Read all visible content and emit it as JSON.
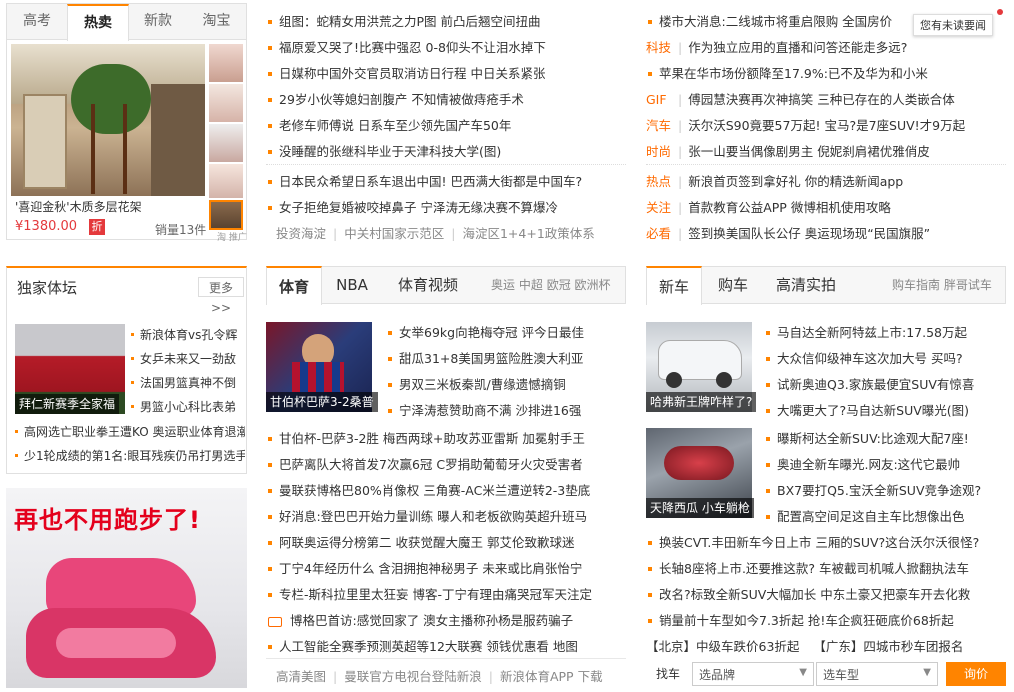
{
  "shop": {
    "tabs": [
      "高考",
      "热卖",
      "新款",
      "淘宝"
    ],
    "caption": "'喜迎金秋'木质多层花架",
    "price": "¥1380.00",
    "badge": "折",
    "sales": "销量13件",
    "logo": "淘 推广"
  },
  "top_news": {
    "items": [
      "组图：蛇精女用洪荒之力P图 前凸后翘空间扭曲",
      "福原爱又哭了!比赛中强忍 0-8仰头不让泪水掉下",
      "日媒称中国外交官员取消访日行程 中日关系紧张",
      "29岁小伙等媳妇剖腹产 不知情被做痔疮手术",
      "老修车师傅说 日系车至少领先国产车50年",
      "没睡醒的张继科毕业于天津科技大学(图)",
      "日本民众希望日系车退出中国! 巴西满大街都是中国车?",
      "女子拒绝复婚被咬掉鼻子 宁泽涛无缘决赛不算爆冷"
    ],
    "footer": [
      "投资海淀",
      "中关村国家示范区",
      "海淀区1+4+1政策体系"
    ]
  },
  "right_news": {
    "items": [
      {
        "tag": "",
        "text": "楼市大消息:二线城市将重启限购 全国房价"
      },
      {
        "tag": "科技",
        "text": "作为独立应用的直播和问答还能走多远?"
      },
      {
        "tag": "",
        "text": "苹果在华市场份额降至17.9%:已不及华为和小米"
      },
      {
        "tag": "GIF",
        "text": "傅园慧決赛再次神搞笑 三种已存在的人类嵌合体"
      },
      {
        "tag": "汽车",
        "text": "沃尔沃S90竟要57万起! 宝马?是7座SUV!才9万起"
      },
      {
        "tag": "时尚",
        "text": "张一山要当偶像剧男主 倪妮刹肩裙优雅俏皮"
      },
      {
        "tag": "热点",
        "text": "新浪首页签到拿好礼 你的精选新闻app"
      },
      {
        "tag": "关注",
        "text": "首款教育公益APP 微博相机使用攻略"
      },
      {
        "tag": "必看",
        "text": "签到换美国队长公仔 奥运现场现“民国旗服”"
      }
    ],
    "tooltip": "您有未读要闻"
  },
  "sports_side": {
    "title": "独家体坛",
    "more": "更多>>",
    "caption": "拜仁新赛季全家福",
    "list": [
      "新浪体育vs孔令辉",
      "女乒未来又一劲敌",
      "法国男篮真神不倒",
      "男篮小心科比表弟"
    ],
    "lines": [
      "高网选亡职业拳王遭KO 奥运职业体育退潮",
      "少1轮成绩的第1名:眼耳残疾仍吊打男选手"
    ]
  },
  "ad": {
    "title": "再也不用跑步了!"
  },
  "sports": {
    "tabs": [
      "体育",
      "NBA",
      "体育视频"
    ],
    "links": [
      "奥运",
      "中超",
      "欧冠",
      "欧洲杯"
    ],
    "caption": "甘伯杯巴萨3-2桑普",
    "side": [
      "女举69kg向艳梅夺冠 评今日最佳",
      "甜瓜31+8美国男篮险胜澳大利亚",
      "男双三米板秦凯/曹缘遗憾摘铜",
      "宁泽涛惹赞助商不满 沙排进16强"
    ],
    "items": [
      "甘伯杯-巴萨3-2胜 梅西两球+助攻苏亚雷斯 加冕射手王",
      "巴萨离队大将首发7次赢6冠 C罗捐助葡萄牙火灾受害者",
      "曼联获博格巴80%肖像权 三角赛-AC米兰遭逆转2-3垫底",
      "好消息:登巴巴开始力量训练 曝人和老板欲购英超升班马",
      "阿联奥运得分榜第二 收获觉醒大魔王 郭艾伦致歉球迷",
      "丁宁4年经历什么 含泪拥抱神秘男子 未来或比肩张怡宁",
      "专栏-斯科拉里里太狂妄 博客-丁宁有理由痛哭冠军天注定",
      "博格巴首访:感觉回家了 澳女主播称孙杨是服药骗子",
      "人工智能全赛季预测英超等12大联赛 领钱优惠看 地图"
    ],
    "footer": [
      "高清美图",
      "曼联官方电视台登陆新浪",
      "新浪体育APP 下载"
    ]
  },
  "auto": {
    "tabs": [
      "新车",
      "购车",
      "高清实拍"
    ],
    "links": [
      "购车指南",
      "胖哥试车"
    ],
    "cap1": "哈弗新王牌咋样了?",
    "cap2": "天降西瓜 小车躺枪",
    "side1": [
      "马自达全新阿特兹上市:17.58万起",
      "大众信仰级神车这次加大号 买吗?",
      "试新奥迪Q3.家族最便宜SUV有惊喜",
      "大嘴更大了?马自达新SUV曝光(图)"
    ],
    "side2": [
      "曝斯柯达全新SUV:比途观大配7座!",
      "奥迪全新车曝光.网友:这代它最帅",
      "BX7要打Q5.宝沃全新SUV竞争途观?",
      "配置高空间足这自主车比想像出色"
    ],
    "items": [
      "换装CVT.丰田新车今日上市 三厢的SUV?这台沃尔沃很怪?",
      "长轴8座将上市.还要推这款? 车被截司机喊人掀翻执法车",
      "改名?标致全新SUV大幅加长 中东土豪又把豪车开去化救",
      "销量前十车型如今7.3折起 抢!车企疯狂砸底价68折起"
    ],
    "last1": "【北京】中级车跌价63折起",
    "last2": "【广东】四城市秒车团报名",
    "search_label": "找车",
    "brand_placeholder": "选品牌",
    "model_placeholder": "选车型",
    "button": "询价"
  }
}
